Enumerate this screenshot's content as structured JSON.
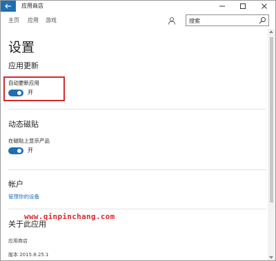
{
  "window": {
    "title": "应用商店",
    "back_icon": "back-arrow-icon",
    "controls": [
      "minimize-icon",
      "maximize-icon",
      "close-icon"
    ]
  },
  "nav": {
    "items": [
      "主页",
      "应用",
      "游戏"
    ],
    "account_icon": "user-icon",
    "search": {
      "placeholder": "搜索",
      "value": "",
      "icon": "search-icon"
    }
  },
  "page": {
    "title": "设置",
    "app_updates": {
      "heading": "应用更新",
      "setting_label": "自动更新应用",
      "toggle_state": "开"
    },
    "live_tile": {
      "heading": "动态磁贴",
      "setting_label": "在磁贴上显示产品",
      "toggle_state": "开"
    },
    "account": {
      "heading": "帐户",
      "link": "管理你的设备"
    },
    "about": {
      "heading": "关于此应用",
      "lines": [
        "应用商店",
        "",
        "版本 2015.8.25.1"
      ]
    }
  },
  "watermark": "www.qinpinchang.com",
  "colors": {
    "accent": "#1f6fb3",
    "highlight": "#d12a2a",
    "watermark": "#e0262a"
  }
}
